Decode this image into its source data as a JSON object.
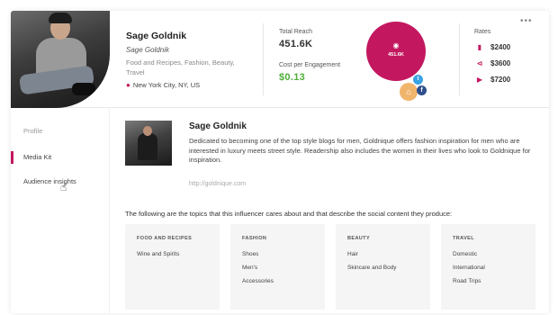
{
  "profile": {
    "name": "Sage Goldnik",
    "handle": "Sage Goldnik",
    "categories": "Food and Recipes, Fashion, Beauty, Travel",
    "location": "New York City, NY, US"
  },
  "metrics": {
    "reach_label": "Total Reach",
    "reach_value": "451.6K",
    "cpe_label": "Cost per Engagement",
    "cpe_value": "$0.13"
  },
  "reach_bubble": {
    "value": "451.6K",
    "color": "#c3185f"
  },
  "rates": {
    "title": "Rates",
    "items": [
      {
        "icon": "bookmark-icon",
        "value": "$2400"
      },
      {
        "icon": "share-icon",
        "value": "$3600"
      },
      {
        "icon": "play-icon",
        "value": "$7200"
      }
    ]
  },
  "sidebar": {
    "items": [
      {
        "label": "Profile"
      },
      {
        "label": "Media Kit"
      },
      {
        "label": "Audience insights"
      }
    ]
  },
  "media_kit": {
    "name": "Sage Goldnik",
    "bio": "Dedicated to becoming one of the top style blogs for men, Goldnique offers fashion inspiration for men who are interested in luxury meets street style. Readership also includes the women in their lives who look to Goldnique for inspiration.",
    "url": "http://goldnique.com",
    "topics_intro": "The following are the topics that this influencer cares about and that describe the social content they produce:",
    "topics": [
      {
        "title": "FOOD AND RECIPES",
        "items": [
          "Wine and Spirits"
        ]
      },
      {
        "title": "FASHION",
        "items": [
          "Shoes",
          "Men's",
          "Accessories"
        ]
      },
      {
        "title": "BEAUTY",
        "items": [
          "Hair",
          "Skincare and Body"
        ]
      },
      {
        "title": "TRAVEL",
        "items": [
          "Domestic",
          "International",
          "Road Trips"
        ]
      }
    ]
  },
  "colors": {
    "accent": "#c3185f",
    "green": "#4fae3b",
    "twitter": "#3aa3e3",
    "facebook": "#2f4e8c",
    "home": "#f0b56d"
  }
}
